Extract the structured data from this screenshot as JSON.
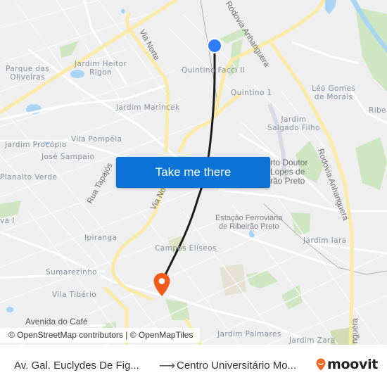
{
  "map": {
    "labels": {
      "parque_das_oliveiras": "Parque das\nOliveiras",
      "jardim_heitor_rigon": "Jardim Heitor\nRigon",
      "quintino_facci_ii": "Quintino Facci II",
      "quintino_1": "Quintino 1",
      "leo_gomes_de_morais": "Léo Gomes\nde Morais",
      "ribeirao": "Ribei",
      "jardim_marincek": "Jardim Marincek",
      "jardim_salgado_filho": "Jardim\nSalgado Filho",
      "vila_pompeia": "Vila Pompéia",
      "jardim_procopio": "Jardim Procópio",
      "jose_sampaio": "José Sampaio",
      "planalto_verde": "Planalto Verde",
      "aeroporto": "rto Doutor\nLopes de\nrão Preto",
      "estacao": "Estação Ferroviária\nde Ribeirão Preto",
      "jardim_iara": "Jardim Iara",
      "va_i": "va I",
      "ipiranga": "Ipiranga",
      "campos_eliseos": "Campos Elíseos",
      "sumarezinho": "Sumarezinho",
      "vila_tiberio": "Vila Tibério",
      "avenida_do_cafe": "Avenida do Café",
      "jardim_palmares": "Jardim Palmares",
      "jardim_zara": "Jardim Zara"
    },
    "roads": {
      "via_norte": "Via Norte",
      "via_norte_2": "Via No",
      "rua_tapajos": "Rua Tapajós",
      "rodovia_anhanguera": "Rodovia Anhanguera",
      "rodovia_anhanguera_2": "Rodovia Anhanguera",
      "anhanguera_3": "nguera"
    },
    "origin_marker": {
      "icon": "origin-dot-icon",
      "color": "#2f7df6"
    },
    "destination_marker": {
      "icon": "destination-pin-icon",
      "color": "#f05a1a"
    },
    "route_color": "#1c1c1c",
    "cta_label": "Take me there",
    "attribution": "© OpenStreetMap contributors | © OpenMapTiles"
  },
  "footer": {
    "from": "Av. Gal. Euclydes De Fig...",
    "arrow": "⟶",
    "to": "Centro Universitário Mo...",
    "brand": "moovit",
    "brand_color": "#f26a21"
  }
}
